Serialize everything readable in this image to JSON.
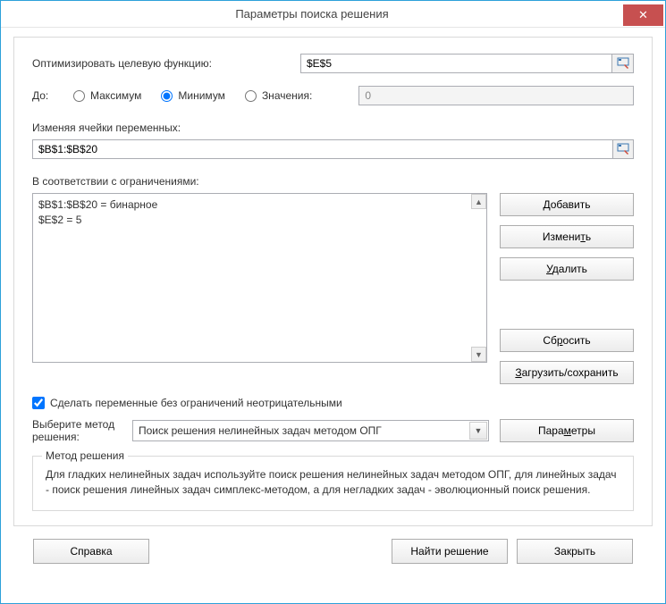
{
  "window": {
    "title": "Параметры поиска решения"
  },
  "objective": {
    "label": "Оптимизировать целевую функцию:",
    "value": "$E$5"
  },
  "to": {
    "label": "До:",
    "options": {
      "max": "Максимум",
      "min": "Минимум",
      "val": "Значения:"
    },
    "selected": "min",
    "value_input": "0"
  },
  "variables": {
    "label": "Изменяя ячейки переменных:",
    "value": "$B$1:$B$20"
  },
  "constraints": {
    "label": "В соответствии с ограничениями:",
    "lines": [
      "$B$1:$B$20 = бинарное",
      "$E$2 = 5"
    ]
  },
  "buttons": {
    "add": "Добавить",
    "change": "Изменить",
    "delete": "Удалить",
    "reset": "Сбросить",
    "load_save": "Загрузить/сохранить",
    "params": "Параметры",
    "help": "Справка",
    "solve": "Найти решение",
    "close": "Закрыть"
  },
  "nonneg": {
    "label": "Сделать переменные без ограничений неотрицательными",
    "checked": true
  },
  "method": {
    "label": "Выберите метод решения:",
    "selected": "Поиск решения нелинейных задач методом ОПГ"
  },
  "groupbox": {
    "title": "Метод решения",
    "text": "Для гладких нелинейных задач используйте поиск решения нелинейных задач методом ОПГ, для линейных задач - поиск решения линейных задач симплекс-методом, а для негладких задач - эволюционный поиск решения."
  }
}
